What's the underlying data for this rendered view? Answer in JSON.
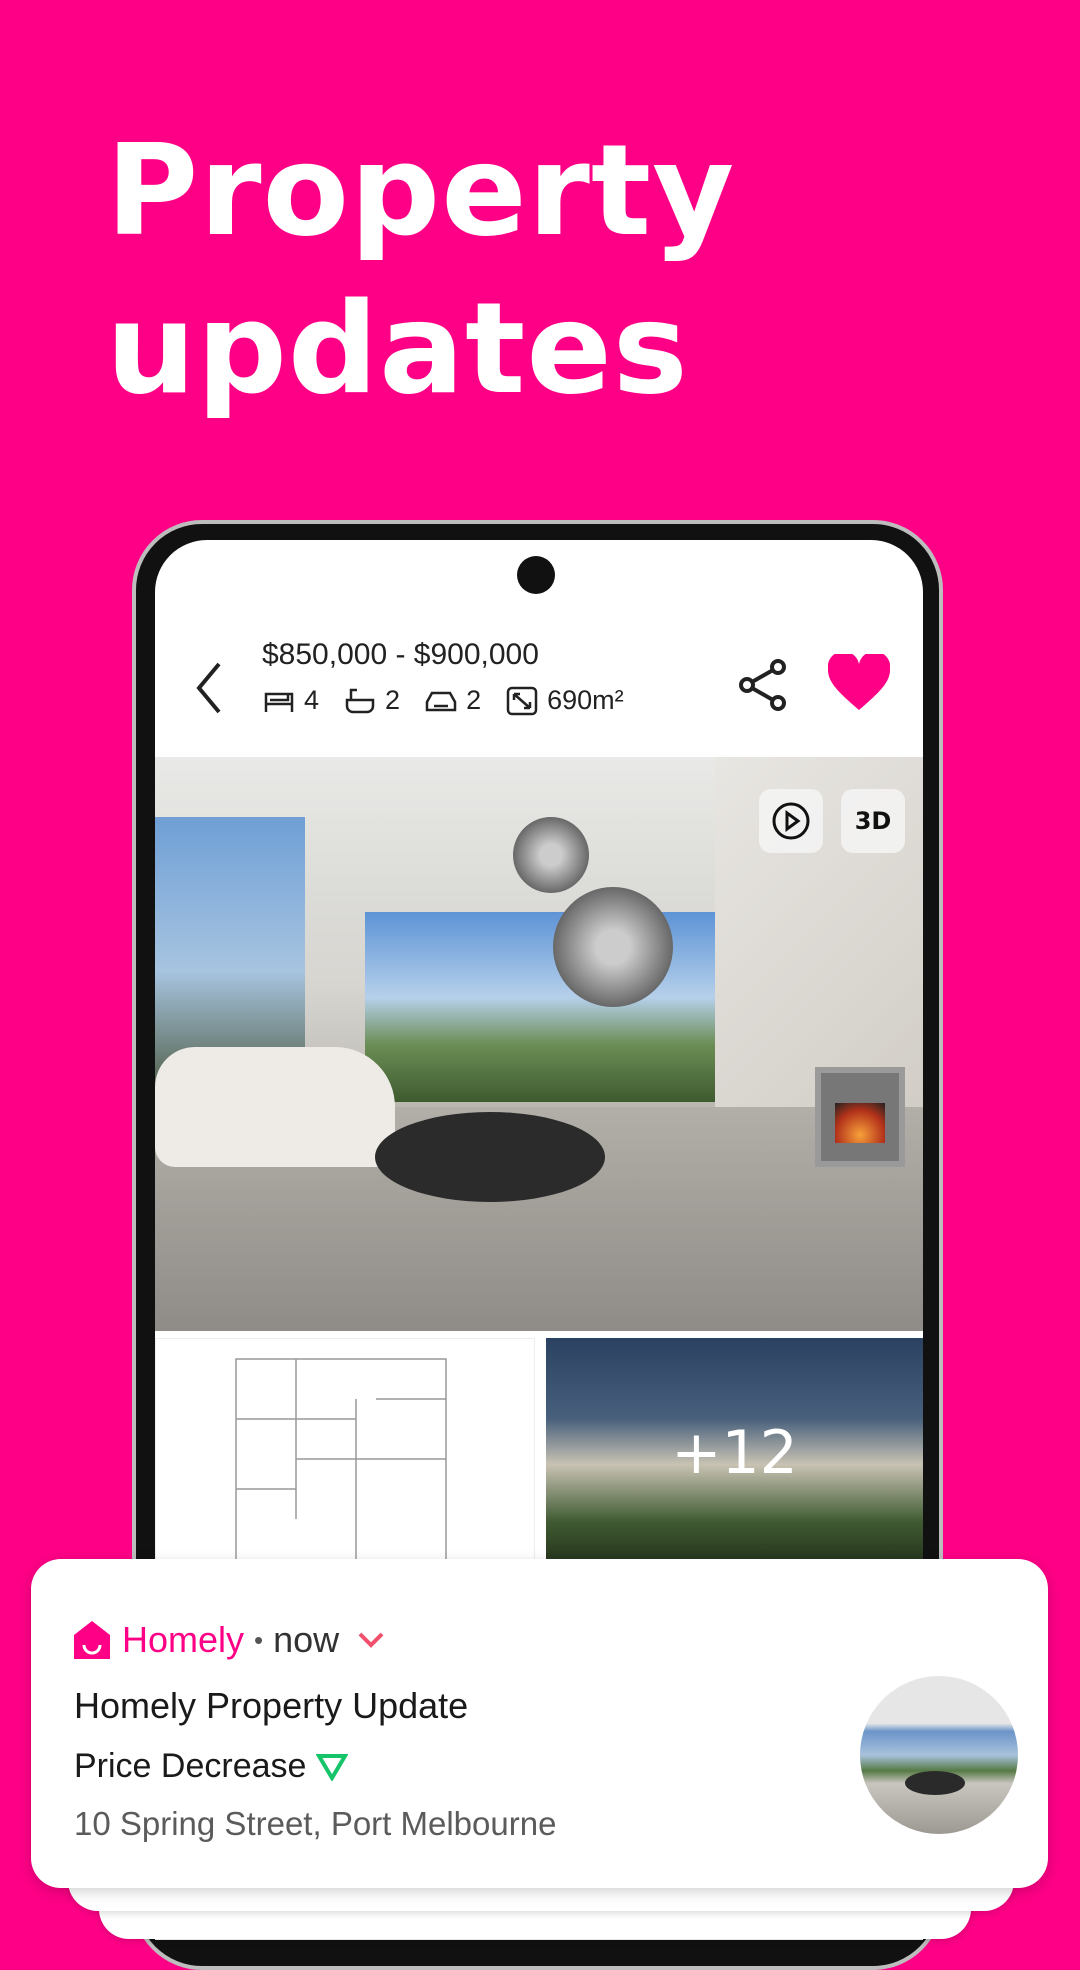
{
  "hero": {
    "line1": "Property",
    "line2": "updates"
  },
  "listing": {
    "price": "$850,000 - $900,000",
    "specs": [
      {
        "icon": "bed-icon",
        "value": "4"
      },
      {
        "icon": "bath-icon",
        "value": "2"
      },
      {
        "icon": "car-icon",
        "value": "2"
      },
      {
        "icon": "land-size-icon",
        "value": "690m²"
      }
    ],
    "favorited": true,
    "media_buttons": {
      "video_icon": "play-icon",
      "tour_label": "3D"
    },
    "more_photos": "+12"
  },
  "colors": {
    "brand": "#fe0086",
    "decrease": "#16c46a"
  },
  "notification": {
    "app_name": "Homely",
    "time": "now",
    "title": "Homely Property Update",
    "subtitle": "Price Decrease",
    "address": "10 Spring Street, Port Melbourne"
  }
}
